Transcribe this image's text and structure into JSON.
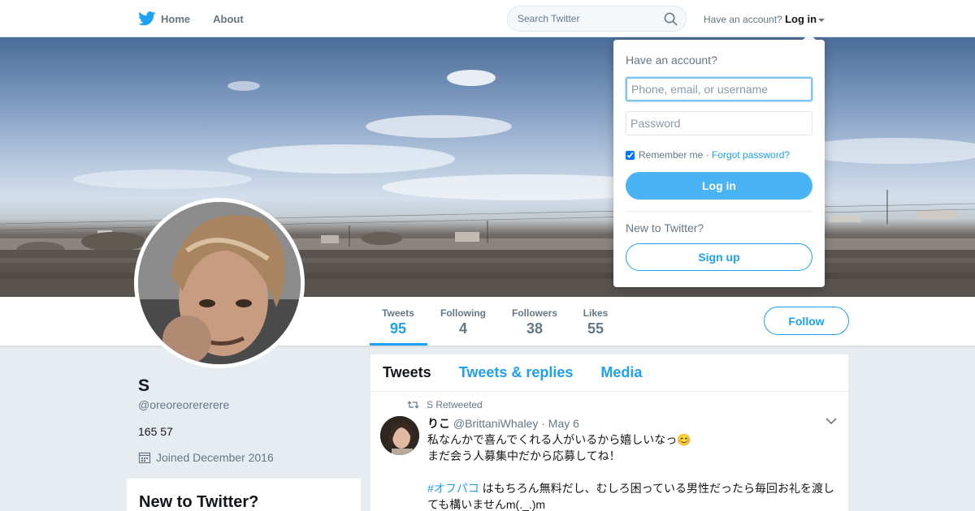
{
  "colors": {
    "accent": "#1da1f2",
    "text": "#14171a",
    "muted": "#657786",
    "background": "#e6ecf0"
  },
  "topbar": {
    "logo_icon": "twitter-bird-icon",
    "nav": [
      {
        "label": "Home"
      },
      {
        "label": "About"
      }
    ],
    "search": {
      "placeholder": "Search Twitter",
      "icon": "search-icon"
    },
    "have_account": "Have an account?",
    "login_label": "Log in"
  },
  "profile": {
    "name": "S",
    "handle": "@oreoreorererere",
    "bio": "165 57",
    "joined": "Joined December 2016",
    "stats": [
      {
        "label": "Tweets",
        "value": "95"
      },
      {
        "label": "Following",
        "value": "4"
      },
      {
        "label": "Followers",
        "value": "38"
      },
      {
        "label": "Likes",
        "value": "55"
      }
    ],
    "follow_label": "Follow"
  },
  "sidebar": {
    "new_to_twitter_title": "New to Twitter?"
  },
  "timeline": {
    "tabs": [
      {
        "label": "Tweets"
      },
      {
        "label": "Tweets & replies"
      },
      {
        "label": "Media"
      }
    ],
    "tweets": [
      {
        "retweeted_by": "S Retweeted",
        "name": "りこ",
        "handle": "@BrittaniWhaley",
        "date": "· May 6",
        "line1": "私なんかで喜んでくれる人がいるから嬉しいなっ😊",
        "line2": "まだ会う人募集中だから応募してね！",
        "hashtag": "#オフパコ",
        "line3": " はもちろん無料だし、むしろ困っている男性だったら毎回お礼を渡しても構いませんm(._.)m"
      }
    ]
  },
  "login_dropdown": {
    "title": "Have an account?",
    "username_placeholder": "Phone, email, or username",
    "password_placeholder": "Password",
    "remember_label": "Remember me",
    "separator": " · ",
    "forgot_label": "Forgot password?",
    "login_button": "Log in",
    "new_label": "New to Twitter?",
    "signup_button": "Sign up"
  }
}
